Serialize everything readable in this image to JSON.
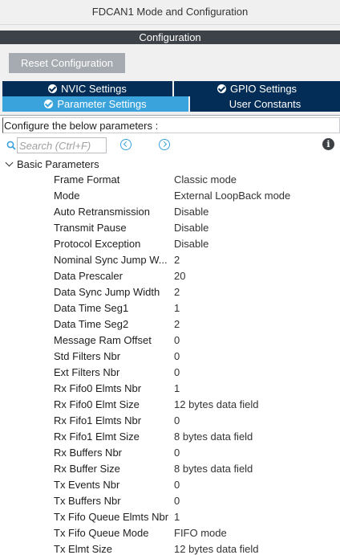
{
  "window": {
    "title": "FDCAN1 Mode and Configuration"
  },
  "section": {
    "title": "Configuration"
  },
  "toolbar": {
    "reset_label": "Reset Configuration"
  },
  "tabs": [
    {
      "label": "NVIC Settings",
      "icon": "check-circle-icon"
    },
    {
      "label": "GPIO Settings",
      "icon": "check-circle-icon"
    },
    {
      "label": "Parameter Settings",
      "icon": "check-circle-icon",
      "active": true
    },
    {
      "label": "User Constants"
    }
  ],
  "panel": {
    "instructions": "Configure the below parameters :",
    "search": {
      "placeholder": "Search (Ctrl+F)",
      "value": ""
    },
    "info_icon": "i",
    "group": {
      "label": "Basic Parameters",
      "expanded": true
    },
    "parameters": [
      {
        "name": "Frame Format",
        "value": "Classic mode"
      },
      {
        "name": "Mode",
        "value": "External LoopBack mode"
      },
      {
        "name": "Auto Retransmission",
        "value": "Disable"
      },
      {
        "name": "Transmit Pause",
        "value": "Disable"
      },
      {
        "name": "Protocol Exception",
        "value": "Disable"
      },
      {
        "name": "Nominal Sync Jump W...",
        "value": "2"
      },
      {
        "name": "Data Prescaler",
        "value": "20"
      },
      {
        "name": "Data Sync Jump Width",
        "value": "2"
      },
      {
        "name": "Data Time Seg1",
        "value": "1"
      },
      {
        "name": "Data Time Seg2",
        "value": "2"
      },
      {
        "name": "Message Ram Offset",
        "value": "0"
      },
      {
        "name": "Std Filters Nbr",
        "value": "0"
      },
      {
        "name": "Ext Filters Nbr",
        "value": "0"
      },
      {
        "name": "Rx Fifo0 Elmts Nbr",
        "value": "1"
      },
      {
        "name": "Rx Fifo0 Elmt Size",
        "value": "12 bytes data field"
      },
      {
        "name": "Rx Fifo1 Elmts Nbr",
        "value": "0"
      },
      {
        "name": "Rx Fifo1 Elmt Size",
        "value": "8 bytes data field"
      },
      {
        "name": "Rx Buffers Nbr",
        "value": "0"
      },
      {
        "name": "Rx Buffer Size",
        "value": "8 bytes data field"
      },
      {
        "name": "Tx Events Nbr",
        "value": "0"
      },
      {
        "name": "Tx Buffers Nbr",
        "value": "0"
      },
      {
        "name": "Tx Fifo Queue Elmts Nbr",
        "value": "1"
      },
      {
        "name": "Tx Fifo Queue Mode",
        "value": "FIFO mode"
      },
      {
        "name": "Tx Elmt Size",
        "value": "12 bytes data field"
      }
    ]
  },
  "colors": {
    "tab_dark": "#032d56",
    "tab_active": "#3aa3dc",
    "section_bar": "#3c4248",
    "reset_button": "#a6abb1"
  }
}
